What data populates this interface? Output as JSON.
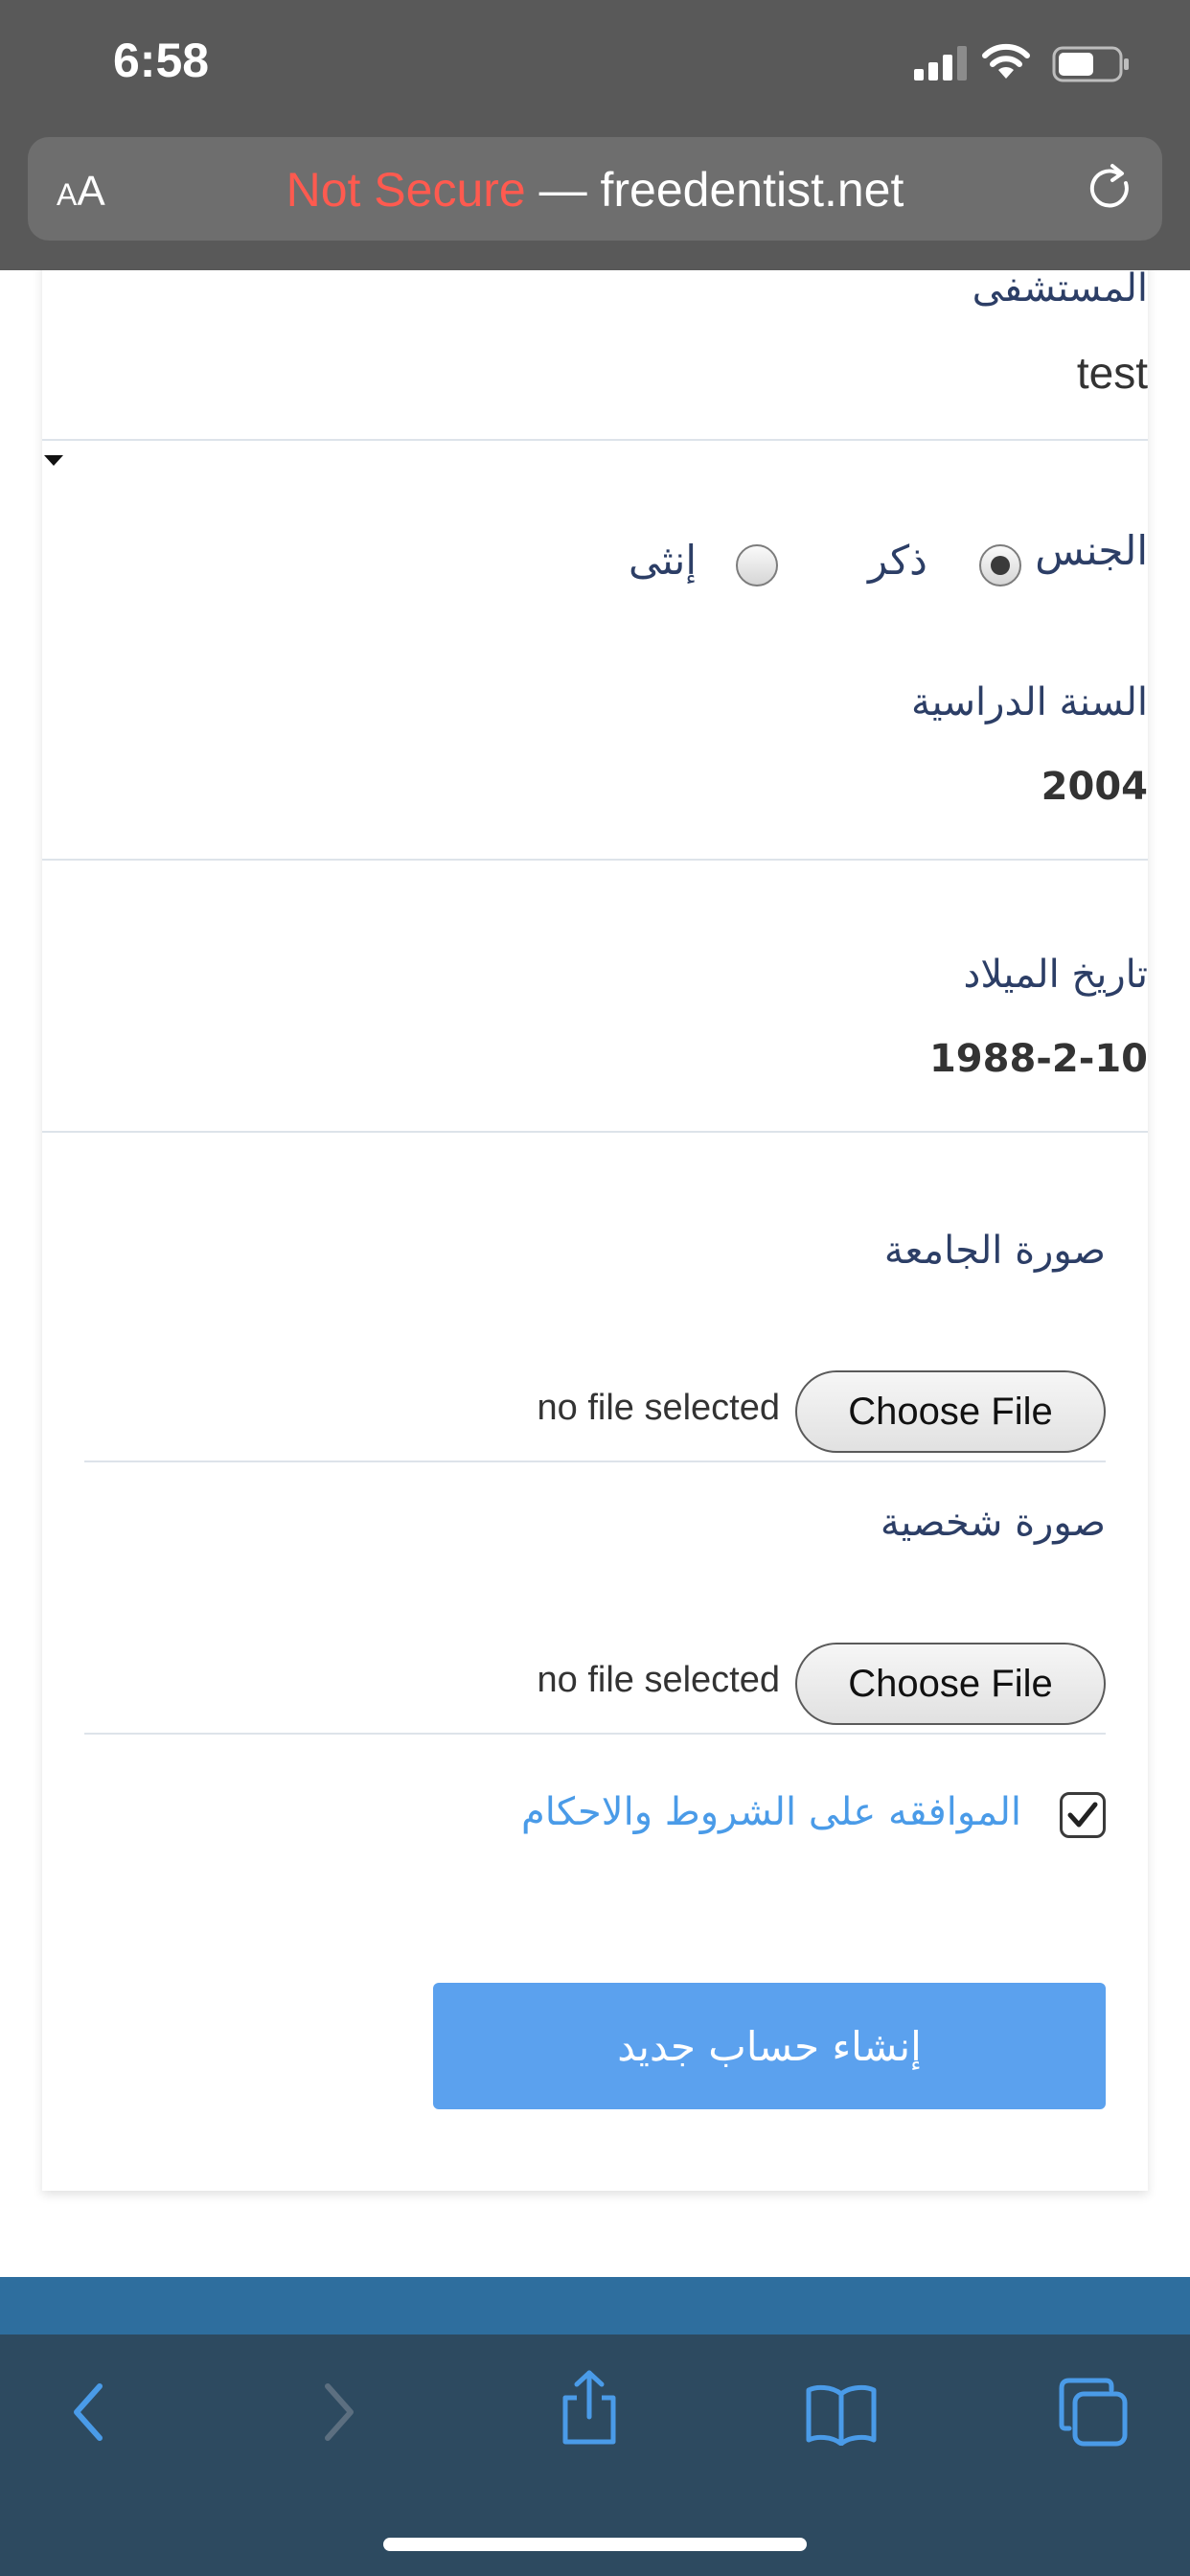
{
  "status_bar": {
    "time": "6:58"
  },
  "address_bar": {
    "aa_small": "A",
    "aa_large": "A",
    "insecure_label": "Not Secure",
    "separator": " — ",
    "domain": "freedentist.net"
  },
  "form": {
    "hospital": {
      "label": "المستشفى",
      "selected": "test"
    },
    "gender": {
      "label": "الجنس",
      "options": [
        {
          "label": "ذكر",
          "checked": true
        },
        {
          "label": "إنثى",
          "checked": false
        }
      ]
    },
    "study_year": {
      "label": "السنة الدراسية",
      "value": "2004"
    },
    "birth_date": {
      "label": "تاريخ الميلاد",
      "value": "1988-2-10"
    },
    "university_photo": {
      "label": "صورة الجامعة",
      "button": "Choose File",
      "status": "no file selected"
    },
    "personal_photo": {
      "label": "صورة شخصية",
      "button": "Choose File",
      "status": "no file selected"
    },
    "terms": {
      "label": "الموافقه على الشروط والاحكام",
      "checked": true
    },
    "submit_label": "إنشاء حساب جديد"
  },
  "colors": {
    "accent": "#5ba1ee",
    "label_text": "#2c3e66",
    "terms_link": "#4a9be8",
    "insecure": "#ff5a4f",
    "toolbar_bg": "#2d4a60",
    "toolbar_icon": "#4a9be8"
  },
  "toolbar_icons": [
    "back-icon",
    "forward-icon",
    "share-icon",
    "bookmarks-icon",
    "tabs-icon"
  ]
}
